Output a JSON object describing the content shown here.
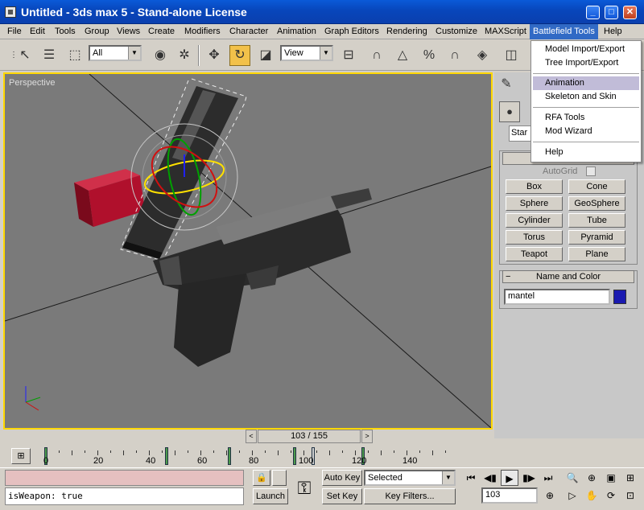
{
  "window": {
    "title": "Untitled - 3ds max 5 - Stand-alone License"
  },
  "menu": {
    "items": [
      "File",
      "Edit",
      "Tools",
      "Group",
      "Views",
      "Create",
      "Modifiers",
      "Character",
      "Animation",
      "Graph Editors",
      "Rendering",
      "Customize",
      "MAXScript",
      "Battlefield Tools",
      "Help"
    ]
  },
  "toolbar": {
    "selection_filter": "All",
    "reference_coord": "View"
  },
  "viewport": {
    "label": "Perspective"
  },
  "dropdown": {
    "items": [
      "Model Import/Export",
      "Tree Import/Export",
      "Animation",
      "Skeleton and Skin",
      "RFA Tools",
      "Mod Wizard",
      "Help"
    ],
    "highlighted": "Animation"
  },
  "command_panel": {
    "tab_label": "Star",
    "object_type": {
      "autogrid_label": "AutoGrid",
      "buttons": [
        "Box",
        "Cone",
        "Sphere",
        "GeoSphere",
        "Cylinder",
        "Tube",
        "Torus",
        "Pyramid",
        "Teapot",
        "Plane"
      ]
    },
    "name_and_color": {
      "header": "Name and Color",
      "name_value": "mantel",
      "color": "#1a1ab0"
    }
  },
  "timeline": {
    "slider_text": "103 / 155",
    "tick_labels": [
      "0",
      "20",
      "40",
      "60",
      "80",
      "100",
      "120",
      "140"
    ]
  },
  "status": {
    "listener_text": "isWeapon: true",
    "auto_key_label": "Auto Key",
    "set_key_label": "Set Key",
    "selected_value": "Selected",
    "key_filters_label": "Key Filters...",
    "launch_label": "Launch",
    "current_frame": "103"
  },
  "colors": {
    "viewport_border": "#ffd800",
    "menu_highlight": "#316ac5",
    "object_red": "#b0102c"
  }
}
